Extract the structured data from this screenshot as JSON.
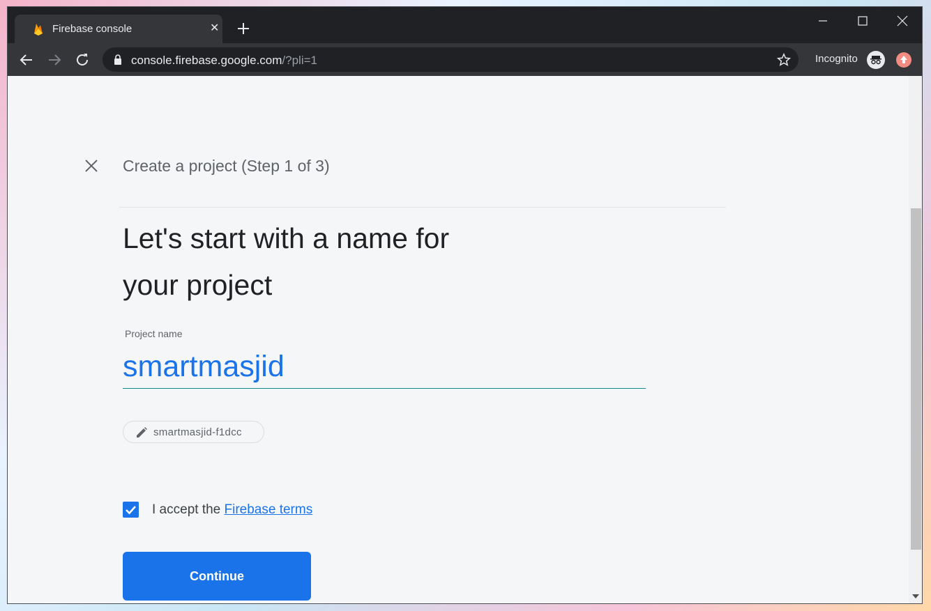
{
  "browser": {
    "tab": {
      "title": "Firebase console",
      "favicon": "firebase-flame-icon"
    },
    "url": {
      "host": "console.firebase.google.com",
      "path": "/?pli=1"
    },
    "profile_label": "Incognito"
  },
  "dialog": {
    "step_title": "Create a project (Step 1 of 3)",
    "headline_line1": "Let's start with a name for",
    "headline_line2": "your project",
    "project_name_label": "Project name",
    "project_name_value": "smartmasjid",
    "project_id_chip": "smartmasjid-f1dcc",
    "accept_prefix": "I accept the ",
    "accept_link": "Firebase terms",
    "terms_checked": true,
    "continue_label": "Continue"
  },
  "colors": {
    "accent": "#1a73e8",
    "chrome_dark": "#202124",
    "page_bg": "#f5f6f8"
  }
}
